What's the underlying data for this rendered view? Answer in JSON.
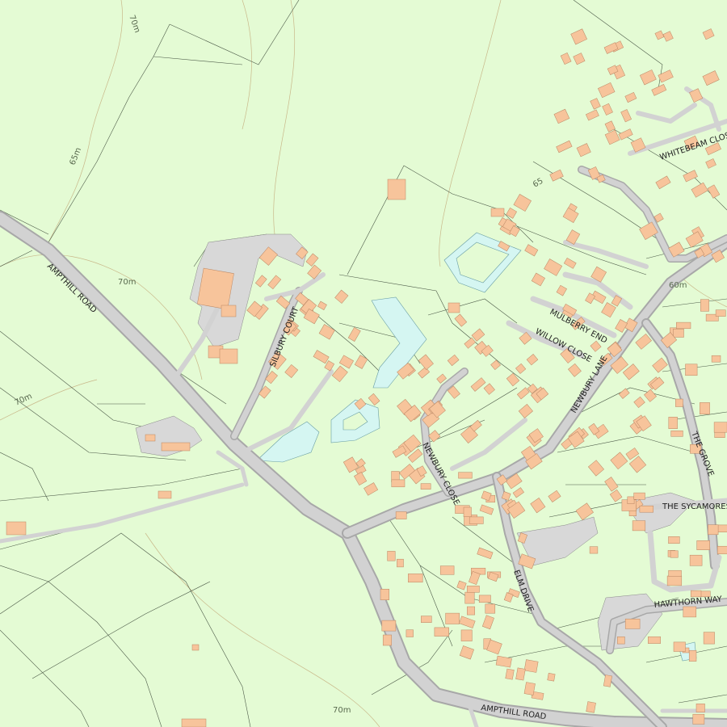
{
  "map": {
    "colors": {
      "land": "#e4fbd4",
      "road_casing": "#a8a8a8",
      "road_fill": "#d2d2d2",
      "building": "#f7c49b",
      "water": "#d5f6f2",
      "boundary": "#4c5a48",
      "contour": "#c9b88a"
    },
    "road_labels": {
      "ampthill_road_nw": "AMPTHILL ROAD",
      "ampthill_road_s": "AMPTHILL ROAD",
      "silbury_court": "SILBURY COURT",
      "newbury_close": "NEWBURY CLOSE",
      "newbury_lane": "NEWBURY LANE",
      "mulberry_end": "MULBERRY END",
      "willow_close": "WILLOW CLOSE",
      "whitebeam_close": "WHITEBEAM CLOSE",
      "the_grove": "THE GROVE",
      "the_sycamores": "THE SYCAMORES",
      "elm_drive": "ELM DRIVE",
      "hawthorn_way": "HAWTHORN WAY"
    },
    "contour_labels": {
      "c1": "70m",
      "c2": "65m",
      "c3": "70m",
      "c4": "70m",
      "c5": "60m",
      "c6": "65",
      "c7": "70m"
    }
  }
}
